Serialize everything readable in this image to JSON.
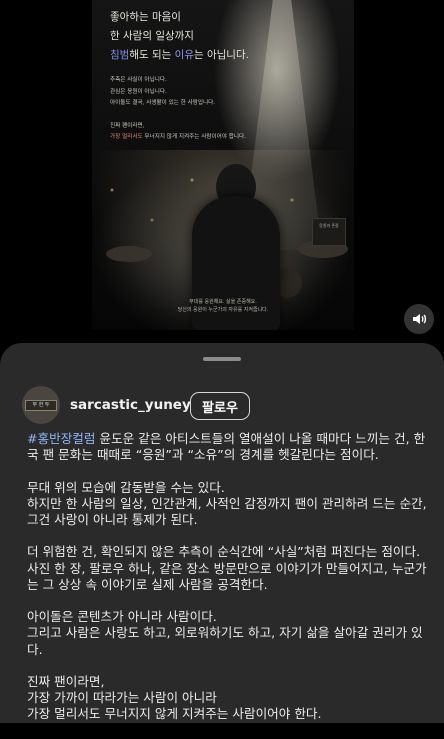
{
  "poster": {
    "line1": "좋아하는 마음이",
    "line2": "한 사람의 일상까지",
    "line3_a": "침범",
    "line3_b": "해도 되는 ",
    "line3_c": "이유",
    "line3_d": "는 아닙니다.",
    "small1": "추측은 사실이 아닙니다.",
    "small2": "관심은 응원이 아닙니다.",
    "small3": "아이돌도 결국, 사생활이 있는 한 사람입니다.",
    "small4": "진짜 팬이라면,",
    "small5_a": "가장 멀리서도",
    "small5_b": " 무너지지 않게 지켜주는 사람이어야 합니다.",
    "caption1": "무대를 응원해요. 삶을 존중해요.",
    "caption2": "당신의 응원이 누군가의 자유를 지켜줍니다.",
    "sign_text": "응원과 존중"
  },
  "post": {
    "username": "sarcastic_yuney",
    "follow_label": "팔로우",
    "avatar_text": "무 한 두",
    "hashtag": "#홍반장컬럼",
    "para1_rest": " 윤도운 같은 아티스트들의 열애설이 나올 때마다 느끼는 건, 한국 팬 문화는 때때로 “응원”과 “소유”의 경계를 헷갈린다는 점이다.",
    "para2": "무대 위의 모습에 감동받을 수는 있다.\n하지만 한 사람의 일상, 인간관계, 사적인 감정까지 팬이 관리하려 드는 순간, 그건 사랑이 아니라 통제가 된다.",
    "para3": "더 위험한 건, 확인되지 않은 추측이 순식간에 “사실”처럼 퍼진다는 점이다.\n사진 한 장, 팔로우 하나, 같은 장소 방문만으로 이야기가 만들어지고, 누군가는 그 상상 속 이야기로 실제 사람을 공격한다.",
    "para4": "아이돌은 콘텐츠가 아니라 사람이다.\n그리고 사람은 사랑도 하고, 외로워하기도 하고, 자기 삶을 살아갈 권리가 있다.",
    "para5": "진짜 팬이라면,\n가장 가까이 따라가는 사람이 아니라\n가장 멀리서도 무너지지 않게 지켜주는 사람이어야 한다."
  },
  "icons": {
    "sound": "speaker-icon"
  },
  "colors": {
    "sheet_bg": "#2a2a2a",
    "hashtag": "#8fb4f5",
    "accent_blue": "#7d8fe6"
  }
}
